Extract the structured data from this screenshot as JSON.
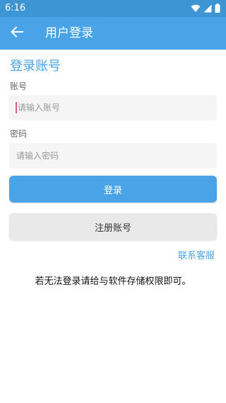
{
  "status_bar": {
    "time": "6:16",
    "icons": [
      "wifi-icon",
      "signal-icon",
      "battery-icon"
    ],
    "background": "#3e95d4"
  },
  "app_bar": {
    "title": "用户登录",
    "back_icon": "arrow-left-icon",
    "background": "#4aa3e6"
  },
  "form": {
    "heading": "登录账号",
    "account": {
      "label": "账号",
      "placeholder": "请输入账号",
      "value": ""
    },
    "password": {
      "label": "密码",
      "placeholder": "请输入密码",
      "value": ""
    },
    "login_label": "登录",
    "register_label": "注册账号",
    "contact_label": "联系客服",
    "notice": "若无法登录请给与软件存储权限即可。"
  },
  "colors": {
    "accent": "#4aa3e6",
    "secondary_button": "#e9e9e9",
    "input_background": "#f5f5f5"
  }
}
